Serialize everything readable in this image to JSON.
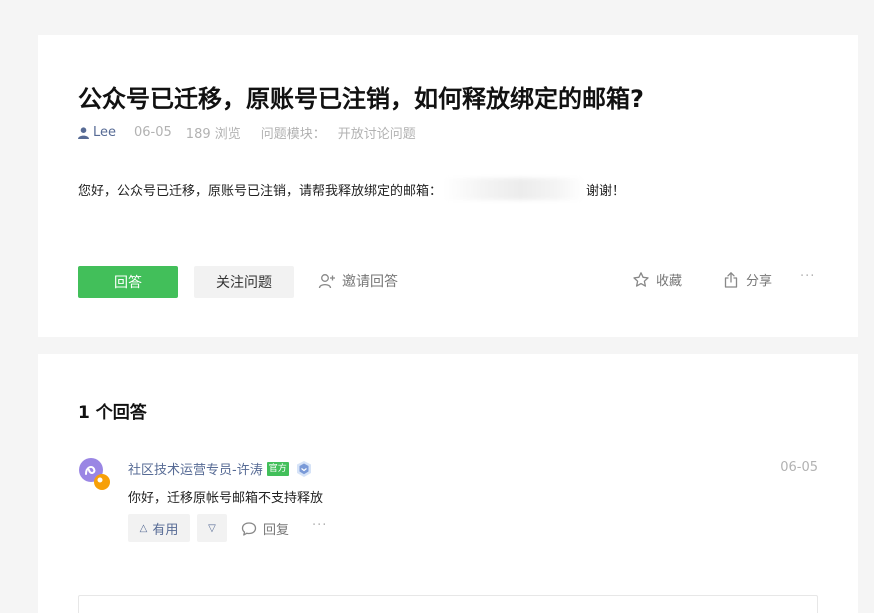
{
  "question": {
    "title": "公众号已迁移，原账号已注销，如何释放绑定的邮箱?",
    "author": "Lee",
    "date": "06-05",
    "views": "189 浏览",
    "module_label": "问题模块：",
    "module": "开放讨论问题",
    "body_prefix": "您好，公众号已迁移，原账号已注销，请帮我释放绑定的邮箱：",
    "body_suffix": "谢谢！",
    "actions": {
      "answer": "回答",
      "follow": "关注问题",
      "invite": "邀请回答",
      "favorite": "收藏",
      "share": "分享",
      "more": "···"
    }
  },
  "answers": {
    "heading": "1 个回答",
    "items": [
      {
        "author": "社区技术运营专员-许涛",
        "badge": "官方",
        "date": "06-05",
        "text": "你好，迁移原帐号邮箱不支持释放",
        "useful": "有用",
        "upvote_glyph": "△",
        "downvote_glyph": "▽",
        "reply": "回复",
        "more": "···"
      }
    ]
  },
  "colors": {
    "accent_green": "#42bf5a",
    "link_blue": "#576b95",
    "page_bg": "#f5f5f5"
  }
}
